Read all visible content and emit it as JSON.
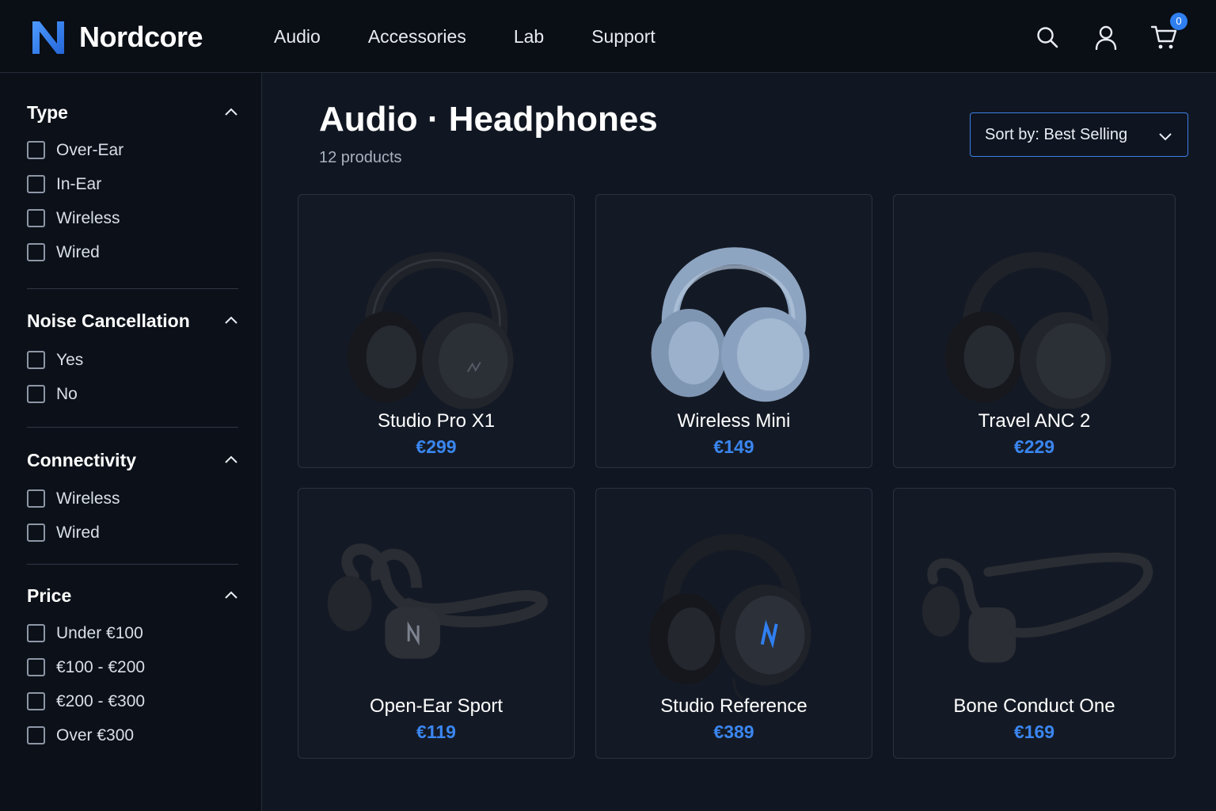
{
  "brand": {
    "name": "Nordcore",
    "accent": "#2f7ff0"
  },
  "nav": [
    {
      "label": "Audio"
    },
    {
      "label": "Accessories"
    },
    {
      "label": "Lab"
    },
    {
      "label": "Support"
    }
  ],
  "header_icons": {
    "search": "search-icon",
    "account": "user-icon",
    "cart": "cart-icon",
    "cart_count": "0"
  },
  "filters": [
    {
      "title": "Type",
      "options": [
        {
          "label": "Over-Ear"
        },
        {
          "label": "In-Ear"
        },
        {
          "label": "Wireless"
        },
        {
          "label": "Wired"
        }
      ]
    },
    {
      "title": "Noise Cancellation",
      "options": [
        {
          "label": "Yes"
        },
        {
          "label": "No"
        }
      ]
    },
    {
      "title": "Connectivity",
      "options": [
        {
          "label": "Wireless"
        },
        {
          "label": "Wired"
        }
      ]
    },
    {
      "title": "Price",
      "options": [
        {
          "label": "Under €100"
        },
        {
          "label": "€100 - €200"
        },
        {
          "label": "€200 - €300"
        },
        {
          "label": "Over €300"
        }
      ]
    }
  ],
  "page": {
    "title": "Audio · Headphones",
    "count": "12 products"
  },
  "sort": {
    "label": "Sort by: Best Selling"
  },
  "products": [
    {
      "name": "Studio Pro X1",
      "price": "€299",
      "color": "#1f2228"
    },
    {
      "name": "Wireless Mini",
      "price": "€149",
      "color": "#8ea5c2"
    },
    {
      "name": "Travel ANC 2",
      "price": "€229",
      "color": "#1f2228"
    },
    {
      "name": "Open-Ear Sport",
      "price": "€119",
      "color": "#25282e"
    },
    {
      "name": "Studio Reference",
      "price": "€389",
      "color": "#1c1f25"
    },
    {
      "name": "Bone Conduct One",
      "price": "€169",
      "color": "#25282e"
    }
  ]
}
